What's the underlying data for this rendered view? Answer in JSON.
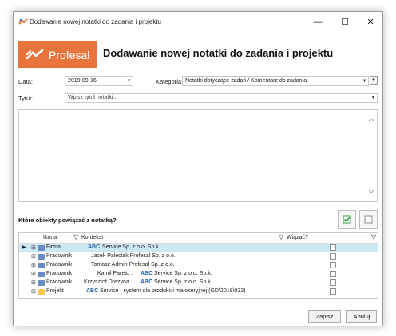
{
  "window": {
    "title": "Dodawanie nowej notatki do zadania i projektu",
    "minimize_glyph": "—",
    "maximize_glyph": "☐",
    "close_glyph": "✕"
  },
  "logo": {
    "text": "Profesal",
    "color": "#e8743b"
  },
  "header": {
    "title": "Dodawanie nowej notatki do zadania i projektu"
  },
  "form": {
    "date_label": "Data:",
    "date_value": "2019-09-16",
    "category_label": "Kategoria:",
    "category_value": "Notatki dotyczące zadań / Komentarz do zadania",
    "title_label": "Tytuł:",
    "title_placeholder": "Wpisz tytuł notatki...",
    "dropdown_glyph": "▼"
  },
  "linking": {
    "question": "Które obiekty powiązać z notatką?"
  },
  "grid": {
    "columns": {
      "icon": "Ikona",
      "context": "Kontekst",
      "link": "Wiązać?"
    },
    "rows": [
      {
        "type": "Firma",
        "abc": "ABC",
        "context": "Service Sp. z o.o. Sp.k.",
        "selected": true,
        "checked": false
      },
      {
        "type": "Pracownik",
        "abc": "",
        "context": "Jacek Paleciak  Profesal Sp. z o.o.",
        "selected": false,
        "checked": false
      },
      {
        "type": "Pracownik",
        "abc": "",
        "context": "Tomasz Admin  Profesal Sp. z o.o.",
        "selected": false,
        "checked": false
      },
      {
        "type": "Pracownik",
        "abc": "ABC",
        "context": "Kamil Pareto ,",
        "context2": "Service Sp. z o.o. Sp.k.",
        "selected": false,
        "checked": false
      },
      {
        "type": "Pracownik",
        "abc": "ABC",
        "context": "Krzysztof Drezyna",
        "context2": "Service Sp. z o.o. Sp.k.",
        "selected": false,
        "checked": false
      },
      {
        "type": "Projekt",
        "abc": "ABC",
        "context": "Service - system dla produkcji małoseryjnej (GD\\2018\\032)",
        "selected": false,
        "checked": false
      }
    ]
  },
  "footer": {
    "save": "Zapisz",
    "cancel": "Anuluj"
  },
  "colors": {
    "selection": "#cce8f6",
    "check_green": "#2e9e3e"
  }
}
